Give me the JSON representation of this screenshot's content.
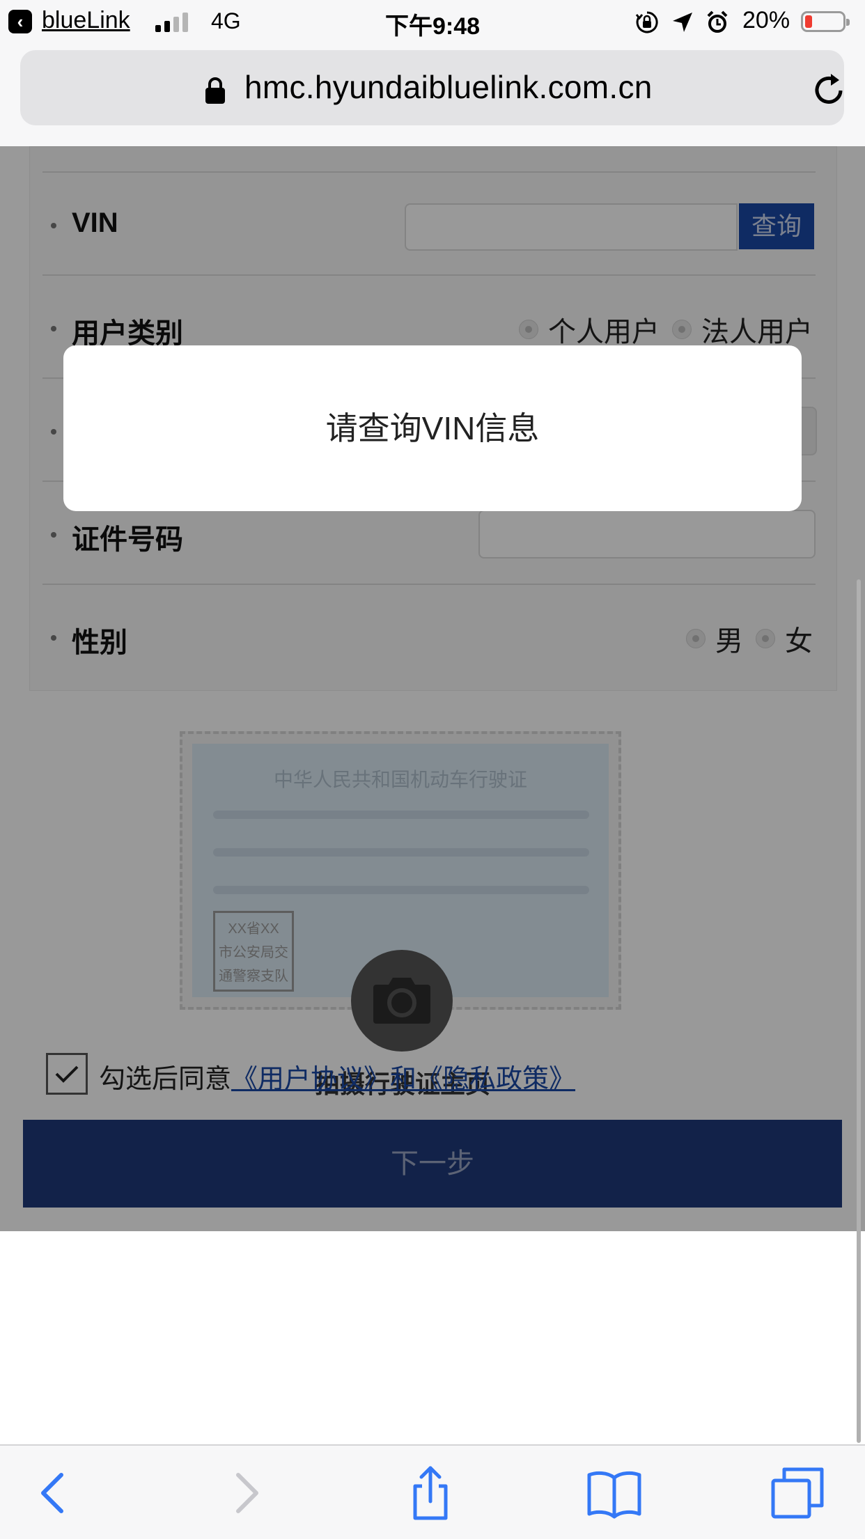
{
  "status_bar": {
    "back_app": "blueLink",
    "network": "4G",
    "time": "下午9:48",
    "battery_percent": "20%",
    "battery_level": 0.2,
    "icons": [
      "orientation-lock-icon",
      "location-arrow-icon",
      "alarm-icon"
    ]
  },
  "browser": {
    "url": "hmc.hyundaibluelink.com.cn"
  },
  "form": {
    "vin": {
      "label": "VIN",
      "input_value": "",
      "query_button": "查询"
    },
    "user_type": {
      "label": "用户类别",
      "options": [
        "个人用户",
        "法人用户"
      ]
    },
    "id_number": {
      "label": "证件号码",
      "input_value": ""
    },
    "gender": {
      "label": "性别",
      "options": [
        "男",
        "女"
      ]
    }
  },
  "license": {
    "caption": "拍摄行驶证主页",
    "card_title": "中华人民共和国机动车行驶证",
    "stamp_lines": [
      "XX省XX",
      "市公安局交",
      "通警察支队"
    ]
  },
  "agreement": {
    "checked": true,
    "prefix": "勾选后同意",
    "link": "《用户协议》和《隐私政策》"
  },
  "next_button": "下一步",
  "modal": {
    "message": "请查询VIN信息"
  },
  "colors": {
    "primary_blue": "#1a49a6",
    "overlay": "rgba(0,0,0,0.4)",
    "battery_low": "#ef3b30"
  }
}
